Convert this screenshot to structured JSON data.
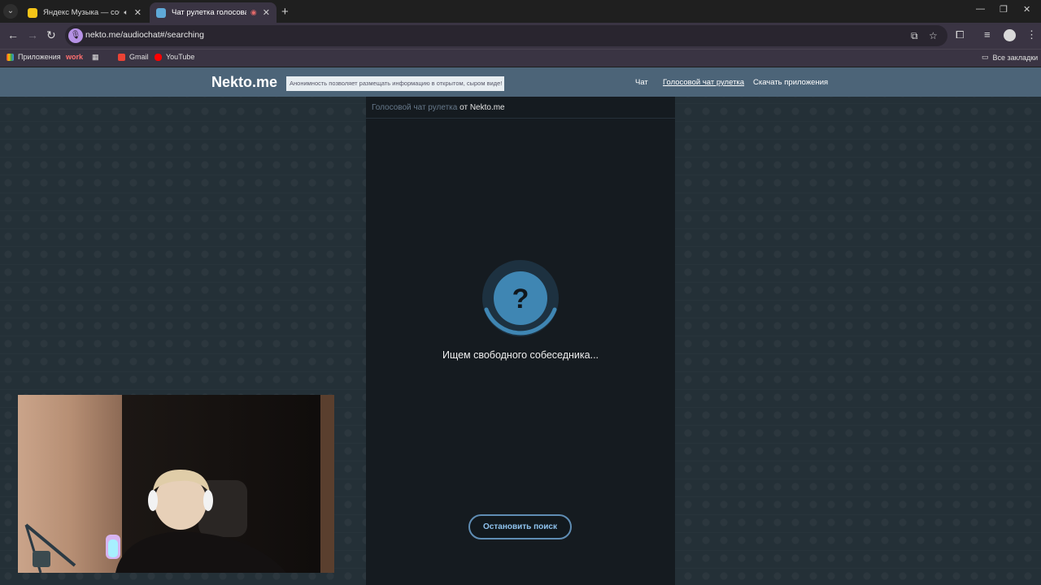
{
  "browser": {
    "tabs": [
      {
        "title": "Яндекс Музыка — собирай",
        "active": false,
        "audio": true
      },
      {
        "title": "Чат рулетка голосовая — I",
        "active": true,
        "recording": true
      }
    ],
    "url": "nekto.me/audiochat#/searching",
    "bookmarks": {
      "apps": "Приложения",
      "work": "work",
      "gmail": "Gmail",
      "youtube": "YouTube",
      "all": "Все закладки"
    }
  },
  "site": {
    "logo": "Nekto.me",
    "notice": "Анонимность позволяет размещать информацию в открытом, сыром виде!",
    "nav": {
      "chat": "Чат",
      "voice": "Голосовой чат рулетка",
      "apps": "Скачать приложения"
    }
  },
  "panel": {
    "breadcrumb_link": "Голосовой чат рулетка",
    "breadcrumb_rest": "от Nekto.me",
    "loader_symbol": "?",
    "status": "Ищем свободного собеседника...",
    "stop_button": "Остановить поиск"
  },
  "colors": {
    "header": "#4c6478",
    "panel": "#151b20",
    "accent": "#5f8db4",
    "loader": "#3f86b3"
  }
}
